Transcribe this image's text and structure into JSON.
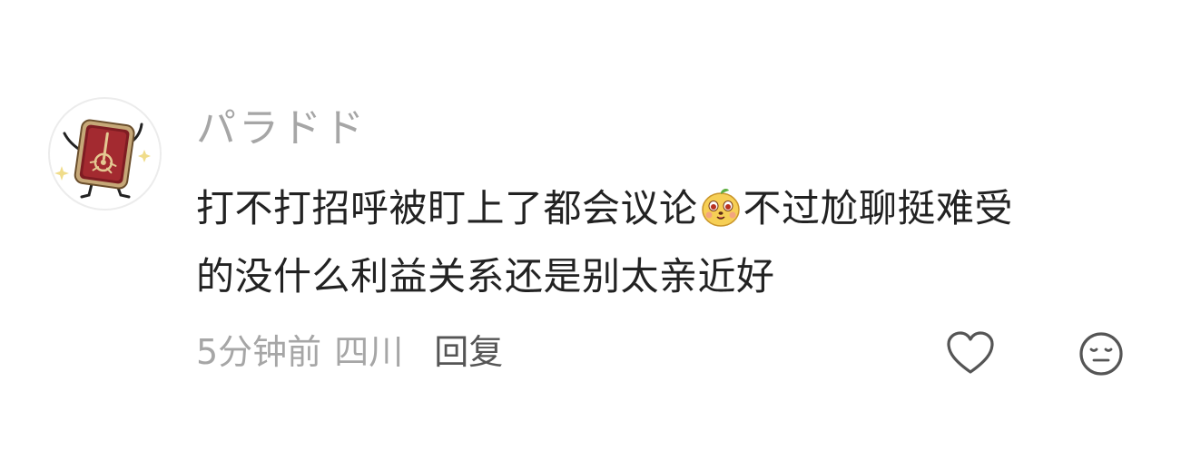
{
  "comment": {
    "user": {
      "name": "パラドド",
      "avatar_icon": "card-character-avatar"
    },
    "text_line_1_before_emoji": "打不打招呼被盯上了都会议论",
    "emoji_icon": "yellow-dog-face-sticker",
    "text_line_1_after_emoji": "不过尬聊挺难受",
    "text_line_2": "的没什么利益关系还是别太亲近好",
    "time": "5分钟前",
    "location": "四川",
    "reply_label": "回复",
    "like_icon": "heart-outline-icon",
    "reaction_icon": "expressionless-face-icon"
  },
  "colors": {
    "username": "#a6a6a6",
    "body_text": "#222222",
    "meta_text": "#a6a6a6",
    "reply_text": "#555555",
    "icon_stroke": "#555555"
  }
}
